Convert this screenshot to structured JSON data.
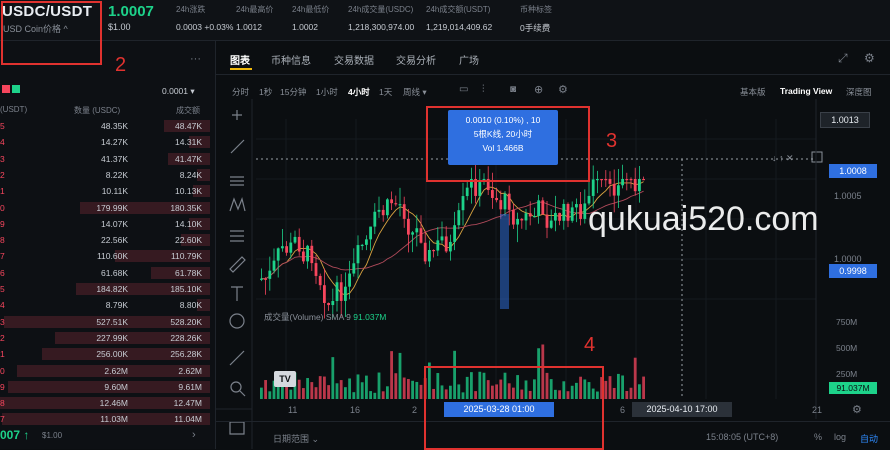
{
  "header": {
    "pair": "USDC/USDT",
    "pair_sub": "USD Coin价格 ^",
    "price": "1.0007",
    "price_usd": "$1.00",
    "stats": [
      {
        "label": "24h涨跌",
        "value": "0.0003 +0.03%"
      },
      {
        "label": "24h最高价",
        "value": "1.0012"
      },
      {
        "label": "24h最低价",
        "value": "1.0002"
      },
      {
        "label": "24h成交量(USDC)",
        "value": "1,218,300,974.00"
      },
      {
        "label": "24h成交额(USDT)",
        "value": "1,219,014,409.62"
      },
      {
        "label": "币种标签",
        "value": "0手续费"
      }
    ]
  },
  "orderbook": {
    "menu": "···",
    "precision": "0.0001 ▾",
    "col_price": "(USDT)",
    "col_qty": "数量 (USDC)",
    "col_total": "成交额",
    "rows": [
      {
        "p": "5",
        "q": "48.35K",
        "t": "48.47K",
        "depth": 0.22
      },
      {
        "p": "4",
        "q": "14.27K",
        "t": "14.31K",
        "depth": 0.1
      },
      {
        "p": "3",
        "q": "41.37K",
        "t": "41.47K",
        "depth": 0.2
      },
      {
        "p": "2",
        "q": "8.22K",
        "t": "8.24K",
        "depth": 0.06
      },
      {
        "p": "1",
        "q": "10.11K",
        "t": "10.13K",
        "depth": 0.08
      },
      {
        "p": "0",
        "q": "179.99K",
        "t": "180.35K",
        "depth": 0.62
      },
      {
        "p": "9",
        "q": "14.07K",
        "t": "14.10K",
        "depth": 0.1
      },
      {
        "p": "8",
        "q": "22.56K",
        "t": "22.60K",
        "depth": 0.14
      },
      {
        "p": "7",
        "q": "110.60K",
        "t": "110.79K",
        "depth": 0.45
      },
      {
        "p": "6",
        "q": "61.68K",
        "t": "61.78K",
        "depth": 0.28
      },
      {
        "p": "5",
        "q": "184.82K",
        "t": "185.10K",
        "depth": 0.64
      },
      {
        "p": "4",
        "q": "8.79K",
        "t": "8.80K",
        "depth": 0.06
      },
      {
        "p": "3",
        "q": "527.51K",
        "t": "528.20K",
        "depth": 0.98
      },
      {
        "p": "2",
        "q": "227.99K",
        "t": "228.26K",
        "depth": 0.74
      },
      {
        "p": "1",
        "q": "256.00K",
        "t": "256.28K",
        "depth": 0.8
      },
      {
        "p": "0",
        "q": "2.62M",
        "t": "2.62M",
        "depth": 0.92
      },
      {
        "p": "9",
        "q": "9.60M",
        "t": "9.61M",
        "depth": 0.96
      },
      {
        "p": "8",
        "q": "12.46M",
        "t": "12.47M",
        "depth": 1.0
      },
      {
        "p": "7",
        "q": "11.03M",
        "t": "11.04M",
        "depth": 0.99
      }
    ],
    "last_price": "007 ↑",
    "last_price_usd": "$1.00",
    "arrow": "›"
  },
  "chart": {
    "tabs": [
      "图表",
      "币种信息",
      "交易数据",
      "交易分析",
      "广场"
    ],
    "timeframes": [
      "分时",
      "1秒",
      "15分钟",
      "1小时",
      "4小时",
      "1天",
      "周线 ▾"
    ],
    "active_timeframe": "4小时",
    "views": [
      "基本版",
      "Trading View",
      "深度图"
    ],
    "active_view": "Trading View",
    "tooltip": {
      "line1": "0.0010 (0.10%) , 10",
      "line2": "5根K线, 20小时",
      "line3": "Vol 1.466B"
    },
    "volume_label": "成交量(Volume) SMA 9",
    "volume_value": "91.037M",
    "price_scale": [
      "1.0013",
      "1.0008",
      "1.0005",
      "1.0000",
      "0.9998"
    ],
    "volume_scale": [
      "750M",
      "500M",
      "250M"
    ],
    "volume_badge": "91.037M",
    "x_ticks": [
      "11",
      "16",
      "2",
      "6",
      "21"
    ],
    "crosshair_start": "2025-03-28  01:00",
    "crosshair_end": "2025-04-10  17:00",
    "date_range": "日期范围 ⌄",
    "clock": "15:08:05 (UTC+8)",
    "footer_percent": "%",
    "footer_log": "log",
    "footer_auto": "自动",
    "tv_logo": "TV"
  },
  "annotations": [
    "2",
    "3",
    "4"
  ],
  "watermark": "qukuai520.com"
}
